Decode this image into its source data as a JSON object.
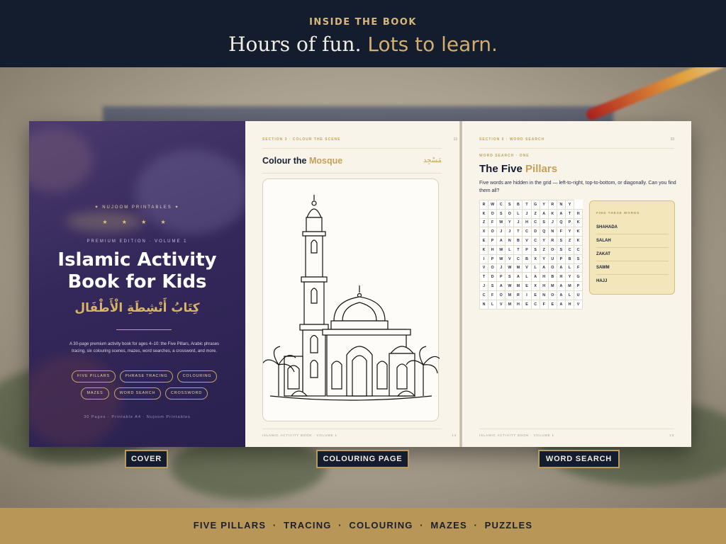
{
  "header": {
    "eyebrow": "INSIDE THE BOOK",
    "headline_main": "Hours of fun.",
    "headline_accent": "Lots to learn."
  },
  "cover": {
    "brand": "✦ NUJOOM PRINTABLES ✦",
    "stars": "★ ★ ★ ★",
    "edition": "PREMIUM EDITION · VOLUME 1",
    "title_line1": "Islamic Activity",
    "title_line2": "Book for Kids",
    "arabic_title": "كِتَابُ أَنْشِطَةِ الْأَطْفَال",
    "description": "A 30-page premium activity book for ages 4–10: the Five Pillars, Arabic phrases tracing, six colouring scenes, mazes, word searches, a crossword, and more.",
    "pills": [
      "FIVE PILLARS",
      "PHRASE TRACING",
      "COLOURING",
      "MAZES",
      "WORD SEARCH",
      "CROSSWORD"
    ],
    "footer": "30 Pages · Printable A4 · Nujoom Printables"
  },
  "colouring_page": {
    "section": "SECTION 3 · COLOUR THE SCENE",
    "page_number": "13",
    "title_main": "Colour the",
    "title_accent": "Mosque",
    "arabic": "مَسْجِد",
    "footer_left": "ISLAMIC ACTIVITY BOOK · VOLUME 1",
    "footer_right": "13"
  },
  "word_search_page": {
    "section": "SECTION 5 · WORD SEARCH",
    "page_number": "23",
    "kicker": "WORD SEARCH · ONE",
    "title_main": "The Five",
    "title_accent": "Pillars",
    "description": "Five words are hidden in the grid — left-to-right, top-to-bottom, or diagonally. Can you find them all?",
    "grid": [
      "RWCSBTGYRNY",
      "KOSOLJZAKATH",
      "ZFWYJHCSJQPK",
      "XOJJTCDQNFYK",
      "EPANBVCYRSZK",
      "KHWLTPSZOSCC",
      "IPWVCBXYUPBS",
      "VOJWMVLAOALF",
      "TDPSALAHBHYG",
      "JSAWMEXHMAMP",
      "CFOMRIENOALU",
      "NLVMHECFEAHV"
    ],
    "find_heading": "FIND THESE WORDS",
    "words": [
      "SHAHADA",
      "SALAH",
      "ZAKAT",
      "SAWM",
      "HAJJ"
    ],
    "footer_left": "ISLAMIC ACTIVITY BOOK · VOLUME 1",
    "footer_right": "23"
  },
  "labels": {
    "cover": "COVER",
    "colouring": "COLOURING PAGE",
    "word_search": "WORD SEARCH"
  },
  "bottom_band": {
    "text": "FIVE PILLARS  ·  TRACING  ·  COLOURING  ·  MAZES  ·  PUZZLES"
  }
}
